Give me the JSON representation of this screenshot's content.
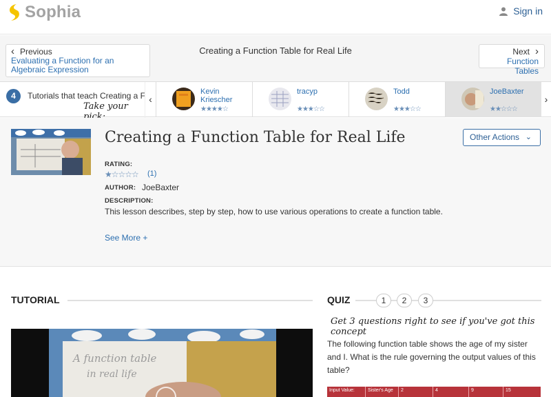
{
  "header": {
    "brand": "Sophia",
    "brand_color": "#f5c400",
    "signin_label": "Sign in"
  },
  "lesson_nav": {
    "prev_label": "Previous",
    "prev_title": "Evaluating a Function for an Algebraic Expression",
    "current_title": "Creating a Function Table for Real Life",
    "next_label": "Next",
    "next_title": "Function Tables"
  },
  "tutorials": {
    "count": "4",
    "heading": "Tutorials that teach Creating a F",
    "pick_prompt": "Take your pick:",
    "cards": [
      {
        "author": "Kevin Kriescher",
        "stars": "★★★★☆",
        "active": false
      },
      {
        "author": "tracyp",
        "stars": "★★★☆☆",
        "active": false
      },
      {
        "author": "Todd",
        "stars": "★★★☆☆",
        "active": false
      },
      {
        "author": "JoeBaxter",
        "stars": "★★☆☆☆",
        "active": true
      }
    ]
  },
  "lesson": {
    "title": "Creating a Function Table for Real Life",
    "other_actions": "Other Actions",
    "rating_label": "RATING:",
    "rating_stars": "★☆☆☆☆",
    "rating_count": "(1)",
    "author_label": "AUTHOR:",
    "author": "JoeBaxter",
    "description_label": "DESCRIPTION:",
    "description": "This lesson describes, step by step, how to use various operations to create a function table.",
    "see_more": "See More +"
  },
  "tutorial_section": {
    "heading": "TUTORIAL"
  },
  "quiz": {
    "heading": "QUIZ",
    "numbers": [
      "1",
      "2",
      "3"
    ],
    "subtitle": "Get 3 questions right to see if you've got this concept",
    "question": "The following function table shows the age of my sister and I. What is the rule governing the output values of this table?",
    "table_header": [
      "Input Value:",
      "Sister's Age",
      "2",
      "4",
      "9",
      "15"
    ],
    "table_color": "#b7333a"
  }
}
